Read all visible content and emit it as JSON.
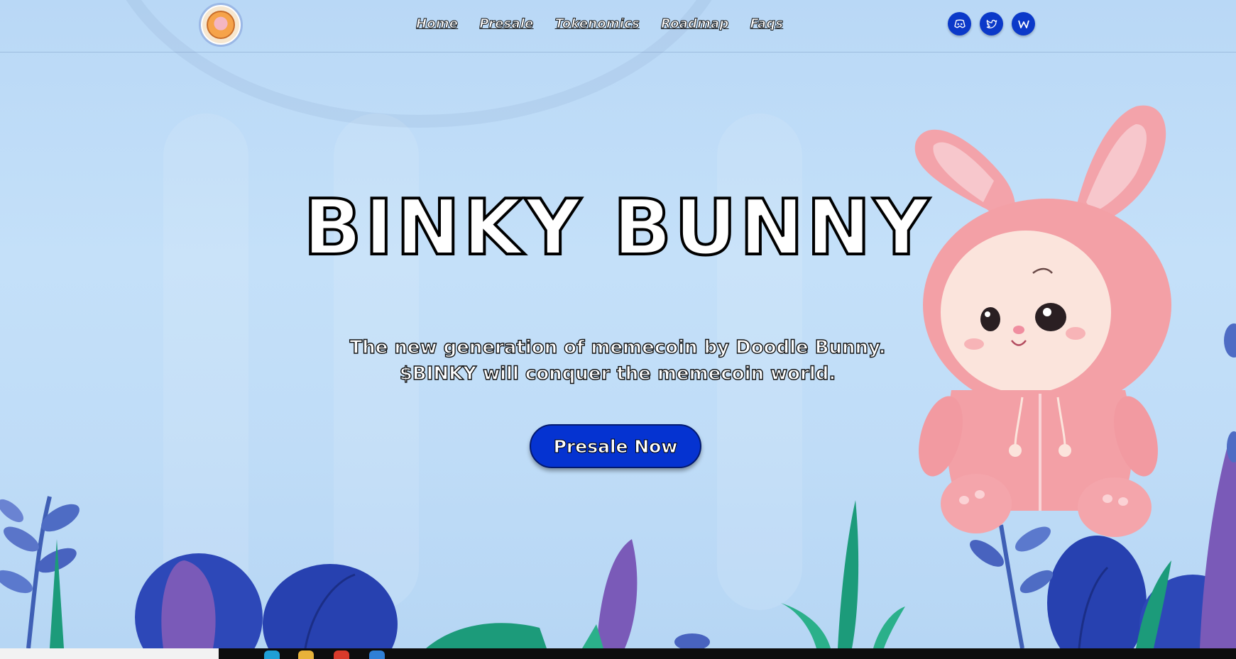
{
  "header": {
    "nav": [
      "Home",
      "Presale",
      "Tokenomics",
      "Roadmap",
      "Faqs"
    ],
    "socials": [
      "discord-icon",
      "twitter-icon",
      "web-icon"
    ]
  },
  "hero": {
    "title": "BINKY BUNNY",
    "subtitle_line1": "The new generation of memecoin by Doodle Bunny.",
    "subtitle_line2": "$BINKY will conquer the memecoin world.",
    "cta_label": "Presale Now"
  },
  "colors": {
    "accent": "#0533d1",
    "background": "#bcdaf7",
    "bunny": "#f3a0a6"
  }
}
